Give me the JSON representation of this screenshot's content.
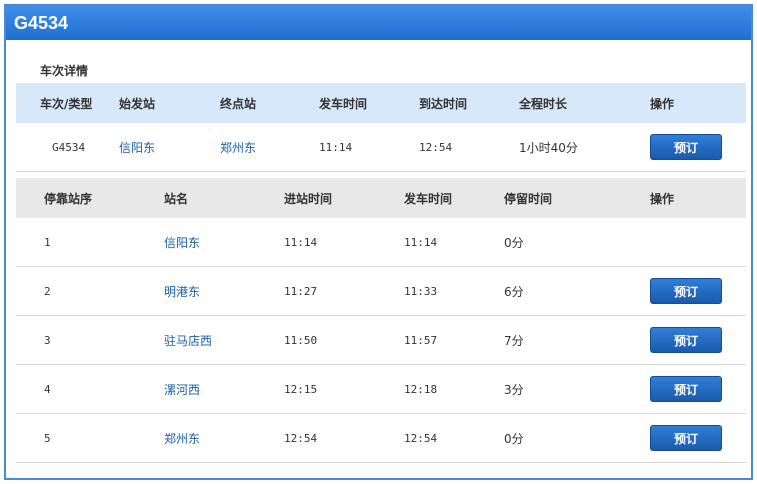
{
  "window": {
    "title": "G4534"
  },
  "section_title": "车次详情",
  "summary": {
    "headers": [
      "车次/类型",
      "始发站",
      "终点站",
      "发车时间",
      "到达时间",
      "全程时长",
      "操作"
    ],
    "train_no": "G4534",
    "origin": "信阳东",
    "destination": "郑州东",
    "depart": "11:14",
    "arrive": "12:54",
    "duration": "1小时40分",
    "book_label": "预订"
  },
  "stops": {
    "headers": [
      "停靠站序",
      "站名",
      "进站时间",
      "发车时间",
      "停留时间",
      "操作"
    ],
    "rows": [
      {
        "seq": "1",
        "name": "信阳东",
        "arrive": "11:14",
        "depart": "11:14",
        "stay": "0分",
        "book": ""
      },
      {
        "seq": "2",
        "name": "明港东",
        "arrive": "11:27",
        "depart": "11:33",
        "stay": "6分",
        "book": "预订"
      },
      {
        "seq": "3",
        "name": "驻马店西",
        "arrive": "11:50",
        "depart": "11:57",
        "stay": "7分",
        "book": "预订"
      },
      {
        "seq": "4",
        "name": "漯河西",
        "arrive": "12:15",
        "depart": "12:18",
        "stay": "3分",
        "book": "预订"
      },
      {
        "seq": "5",
        "name": "郑州东",
        "arrive": "12:54",
        "depart": "12:54",
        "stay": "0分",
        "book": "预订"
      }
    ]
  }
}
